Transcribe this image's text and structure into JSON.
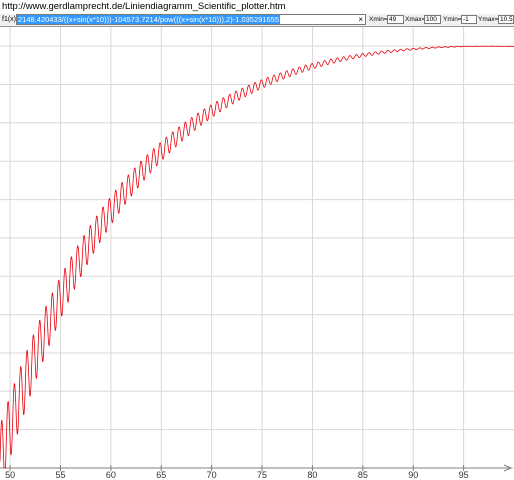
{
  "url": "http://www.gerdlamprecht.de/Liniendiagramm_Scientific_plotter.htm",
  "formula": {
    "label": "f1(x):",
    "value": "2148.420433/((x+sin(x*10)))-104573.7214/pow(((x+sin(x*10))),2)-1.035291655",
    "clear_icon": "×"
  },
  "range": {
    "xmin_label": "Xmin=",
    "xmin": "49",
    "xmax_label": "Xmax=",
    "xmax": "100",
    "ymin_label": "Ymin=",
    "ymin": "-1",
    "ymax_label": "Ymax=",
    "ymax": "10.5"
  },
  "colors": {
    "curve": "#e8000b",
    "grid": "#d8d8d8",
    "axis": "#808080"
  },
  "chart_data": {
    "type": "line",
    "function": "2148.420433/((x+sin(x*10)))-104573.7214/pow(((x+sin(x*10))),2)-1.035291655",
    "xlim": [
      49,
      100
    ],
    "ylim": [
      -1,
      10.5
    ],
    "x_ticks": [
      50,
      55,
      60,
      65,
      70,
      75,
      80,
      85,
      90,
      95
    ],
    "grid": true,
    "series": [
      {
        "color": "#e8000b"
      }
    ]
  }
}
